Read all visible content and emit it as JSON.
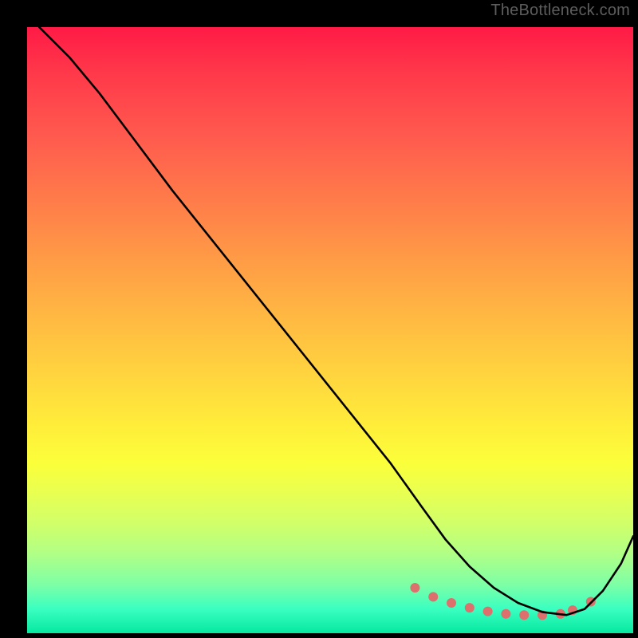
{
  "watermark": "TheBottleneck.com",
  "chart_data": {
    "type": "line",
    "title": "",
    "xlabel": "",
    "ylabel": "",
    "xlim": [
      0,
      100
    ],
    "ylim": [
      0,
      100
    ],
    "grid": false,
    "series": [
      {
        "name": "curve",
        "x": [
          2,
          7,
          12,
          18,
          24,
          30,
          36,
          42,
          48,
          54,
          60,
          65,
          69,
          73,
          77,
          81,
          85,
          89,
          92,
          95,
          98,
          100
        ],
        "values": [
          100,
          95,
          89,
          81,
          73,
          65.5,
          58,
          50.5,
          43,
          35.5,
          28,
          21,
          15.5,
          11,
          7.5,
          5,
          3.5,
          3,
          4,
          7,
          11.5,
          16
        ]
      }
    ],
    "markers": {
      "name": "dotted-segment",
      "x": [
        64,
        67,
        70,
        73,
        76,
        79,
        82,
        85,
        88,
        90,
        93
      ],
      "values": [
        7.5,
        6,
        5,
        4.2,
        3.6,
        3.2,
        3,
        3,
        3.2,
        3.8,
        5.2
      ],
      "color": "#dd6f6c",
      "radius": 6
    },
    "background_gradient": {
      "top": "#ff1a46",
      "mid": "#ffee3a",
      "bottom": "#06e8a0"
    }
  }
}
